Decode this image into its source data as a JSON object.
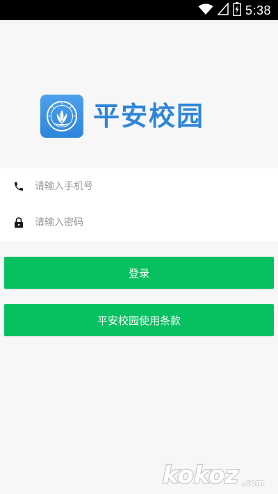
{
  "status_bar": {
    "time": "5:38"
  },
  "logo": {
    "app_name": "平安校园"
  },
  "form": {
    "phone_placeholder": "请输入手机号",
    "password_placeholder": "请输入密码"
  },
  "buttons": {
    "login_label": "登录",
    "terms_label": "平安校园使用条款"
  },
  "watermark": {
    "text": "kokoz.com"
  },
  "colors": {
    "accent_green": "#07c160",
    "brand_blue": "#2f86d8",
    "page_bg": "#f7f7f7"
  },
  "icons": {
    "phone": "phone-icon",
    "lock": "lock-icon",
    "wifi": "wifi-icon",
    "signal": "signal-icon",
    "battery": "battery-icon"
  }
}
